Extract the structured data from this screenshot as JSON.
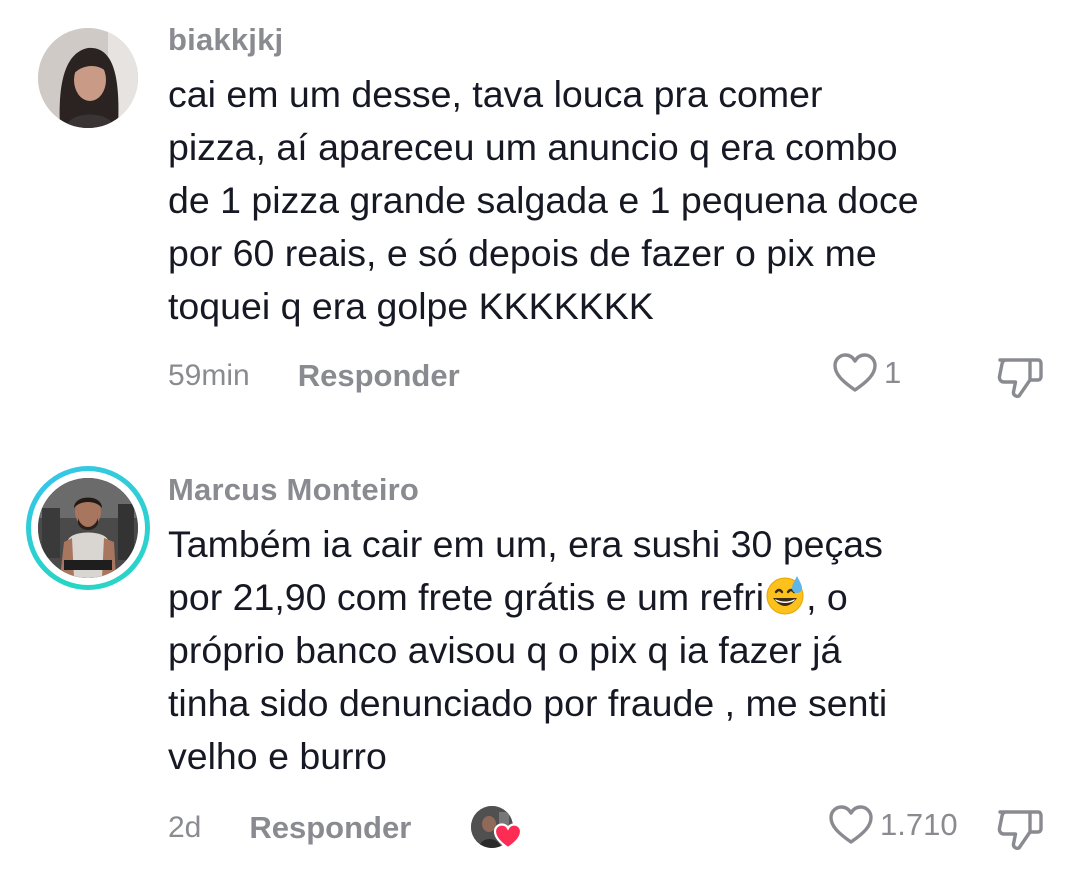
{
  "comments": [
    {
      "username": "biakkjkj",
      "text": "cai em um desse, tava louca pra comer pizza, aí apareceu um anuncio q era combo de 1 pizza grande salgada e 1 pequena doce por 60 reais, e só depois de fazer o pix me toquei q era golpe KKKKKKK",
      "lines": [
        "cai em um desse, tava louca pra comer",
        "pizza, aí apareceu um anuncio q era combo",
        "de 1 pizza grande salgada e 1 pequena doce",
        "por 60 reais, e só depois de fazer o pix me",
        "toquei q era golpe KKKKKKK"
      ],
      "time": "59min",
      "reply_label": "Responder",
      "like_count": "1",
      "has_story_ring": false,
      "liked_by_creator": false
    },
    {
      "username": "Marcus Monteiro",
      "lines": [
        "Também ia cair em um, era sushi 30 peças",
        "por 21,90 com frete grátis e um refri",
        ", o",
        "próprio banco avisou q o pix q ia fazer já",
        "tinha sido denunciado por fraude , me senti",
        "velho e burro"
      ],
      "emoji": "grinning-face-with-sweat",
      "time": "2d",
      "reply_label": "Responder",
      "like_count": "1.710",
      "has_story_ring": true,
      "liked_by_creator": true
    }
  ],
  "colors": {
    "text": "#161823",
    "secondary": "#8a8b91",
    "ring": "#26d6c4",
    "heart_badge": "#fe2c55"
  }
}
